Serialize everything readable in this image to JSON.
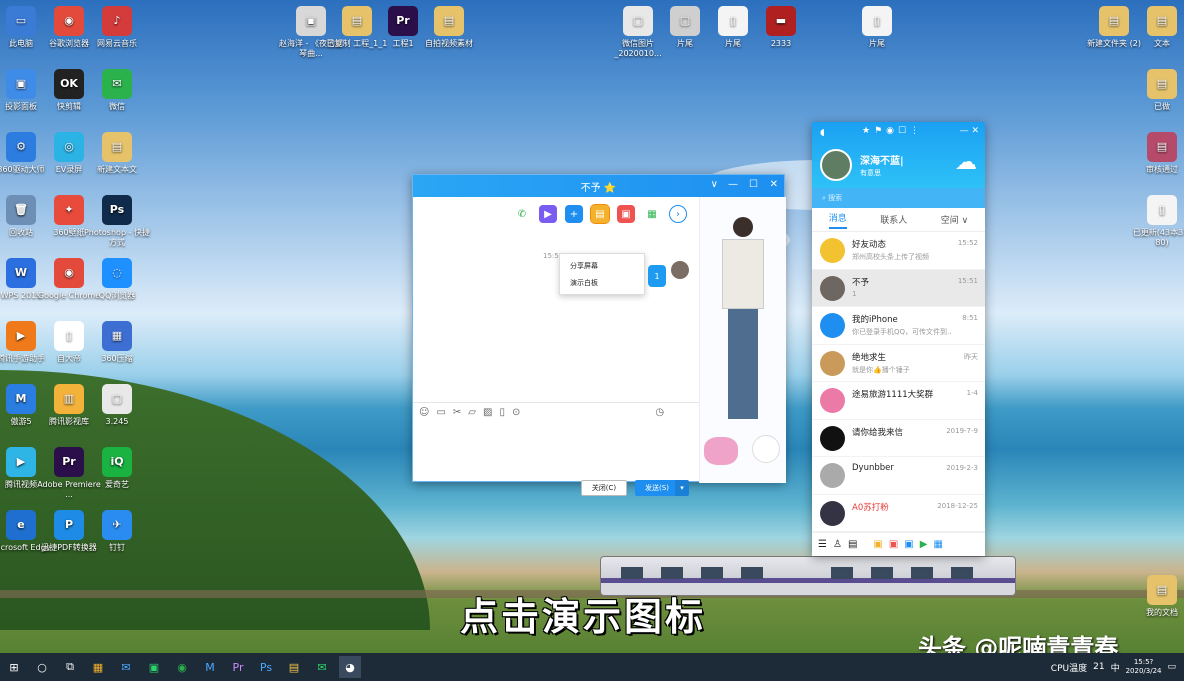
{
  "desktop": {
    "icons_left": [
      {
        "label": "此电脑",
        "color": "#3a7bd5",
        "glyph": "▭"
      },
      {
        "label": "谷歌浏览器",
        "color": "#e44a3b",
        "glyph": "◉"
      },
      {
        "label": "网易云音乐",
        "color": "#d43b3b",
        "glyph": "♪"
      },
      {
        "label": "投影面板",
        "color": "#3f8be8",
        "glyph": "▣"
      },
      {
        "label": "快剪辑",
        "color": "#222",
        "glyph": "OK"
      },
      {
        "label": "微信",
        "color": "#2bb24c",
        "glyph": "✉"
      },
      {
        "label": "360驱动大师",
        "color": "#2d7de0",
        "glyph": "⚙"
      },
      {
        "label": "EV录屏",
        "color": "#2bb3e6",
        "glyph": "◎"
      },
      {
        "label": "新建文本文",
        "color": "#e6c36a",
        "glyph": "▤"
      },
      {
        "label": "回收站",
        "color": "#6e8fb5",
        "glyph": "🗑"
      },
      {
        "label": "360壁纸",
        "color": "#e84b3c",
        "glyph": "✦"
      },
      {
        "label": "Photoshop - 快捷方式",
        "color": "#0f2a4a",
        "glyph": "Ps"
      },
      {
        "label": "WPS 2019",
        "color": "#2b6fe0",
        "glyph": "W"
      },
      {
        "label": "Google Chrome",
        "color": "#e44a3b",
        "glyph": "◉"
      },
      {
        "label": "QQ浏览器",
        "color": "#1e90ff",
        "glyph": "◌"
      },
      {
        "label": "腾讯手游助手",
        "color": "#f07a1a",
        "glyph": "▶"
      },
      {
        "label": "自大帝",
        "color": "#ffffff",
        "glyph": "▯"
      },
      {
        "label": "360压缩",
        "color": "#3d6fd3",
        "glyph": "▦"
      },
      {
        "label": "傲游5",
        "color": "#2a7de1",
        "glyph": "M"
      },
      {
        "label": "腾讯影视库",
        "color": "#f3b23a",
        "glyph": "▥"
      },
      {
        "label": "3.245",
        "color": "#e8e8e8",
        "glyph": "▢"
      },
      {
        "label": "腾讯视频",
        "color": "#2fb4e6",
        "glyph": "▶"
      },
      {
        "label": "Adobe Premiere ...",
        "color": "#2b0f4a",
        "glyph": "Pr"
      },
      {
        "label": "爱奇艺",
        "color": "#1ab342",
        "glyph": "iQ"
      },
      {
        "label": "Microsoft Edge",
        "color": "#1e6fd0",
        "glyph": "e"
      },
      {
        "label": "迅捷PDF转换器",
        "color": "#1e8be6",
        "glyph": "P"
      },
      {
        "label": "钉钉",
        "color": "#2a8cf0",
        "glyph": "✈"
      }
    ],
    "icons_top": [
      {
        "label": "赵海洋 - 《夜的钢琴曲...",
        "color": "#d8d8d8",
        "glyph": "▣"
      },
      {
        "label": "已复制 工程_1_1",
        "color": "#e6c36a",
        "glyph": "▤"
      },
      {
        "label": "工程1",
        "color": "#2b0f4a",
        "glyph": "Pr"
      },
      {
        "label": "自拍视频素材",
        "color": "#e6c36a",
        "glyph": "▤"
      },
      {
        "label": "微信图片_2020010...",
        "color": "#e8e8e8",
        "glyph": "▢"
      },
      {
        "label": "片尾",
        "color": "#cfcfcf",
        "glyph": "▢"
      },
      {
        "label": "片尾",
        "color": "#f4f4f4",
        "glyph": "▯"
      },
      {
        "label": "2333",
        "color": "#b02020",
        "glyph": "▬"
      },
      {
        "label": "片尾",
        "color": "#f4f4f4",
        "glyph": "▯"
      }
    ],
    "icons_right": [
      {
        "label": "新建文件夹 (2)",
        "color": "#e6c36a",
        "glyph": "▤"
      },
      {
        "label": "文本",
        "color": "#e6c36a",
        "glyph": "▤"
      },
      {
        "label": "已做",
        "color": "#e6c36a",
        "glyph": "▤"
      },
      {
        "label": "审核通过",
        "color": "#b54a6a",
        "glyph": "▤"
      },
      {
        "label": "已更新(43本37-80)",
        "color": "#f4f4f4",
        "glyph": "▯"
      },
      {
        "label": "我的文档",
        "color": "#e6c36a",
        "glyph": "▤"
      }
    ]
  },
  "chat_window": {
    "title": "不予 ⭐",
    "controls": {
      "chevron": "∨",
      "min": "—",
      "max": "☐",
      "close": "✕"
    },
    "time": "15:5",
    "menu": [
      "分享屏幕",
      "演示白板"
    ],
    "bubble": "1",
    "close_label": "关闭(C)",
    "send_label": "发送(S)",
    "send_arrow": "▾"
  },
  "qq_panel": {
    "nickname": "深海不蓝|",
    "status": "有意思",
    "search_placeholder": "搜索",
    "tabs": [
      "消息",
      "联系人",
      "空间 ∨"
    ],
    "contacts": [
      {
        "name": "好友动态",
        "preview": "郑州高校头条上传了视频",
        "time": "15:52",
        "color": "#f2c230"
      },
      {
        "name": "不予",
        "preview": "1",
        "time": "15:51",
        "color": "#6d6661"
      },
      {
        "name": "我的iPhone",
        "preview": "你已登录手机QQ，可传文件到...",
        "time": "8:51",
        "color": "#1e8ff0"
      },
      {
        "name": "绝地求生",
        "preview": "就是你👍播个锤子",
        "time": "昨天",
        "color": "#c99a5a"
      },
      {
        "name": "途易旅游1111大奖群",
        "preview": "",
        "time": "1-4",
        "color": "#ec7aa6"
      },
      {
        "name": "请你给我来信",
        "preview": "",
        "time": "2019-7-9",
        "color": "#111"
      },
      {
        "name": "Dyunbber",
        "preview": "",
        "time": "2019-2-3",
        "color": "#aaaaaa"
      },
      {
        "name": "A0苏打粉",
        "preview": "",
        "time": "2018-12-25",
        "color": "#334"
      }
    ]
  },
  "caption": "点击演示图标",
  "watermark": "头条 @呢喃青青春",
  "taskbar": {
    "start": "⊞",
    "tray_weather": "21",
    "ime": "中",
    "time": "15:5?",
    "date": "2020/3/24",
    "cpu_label": "CPU温度"
  }
}
